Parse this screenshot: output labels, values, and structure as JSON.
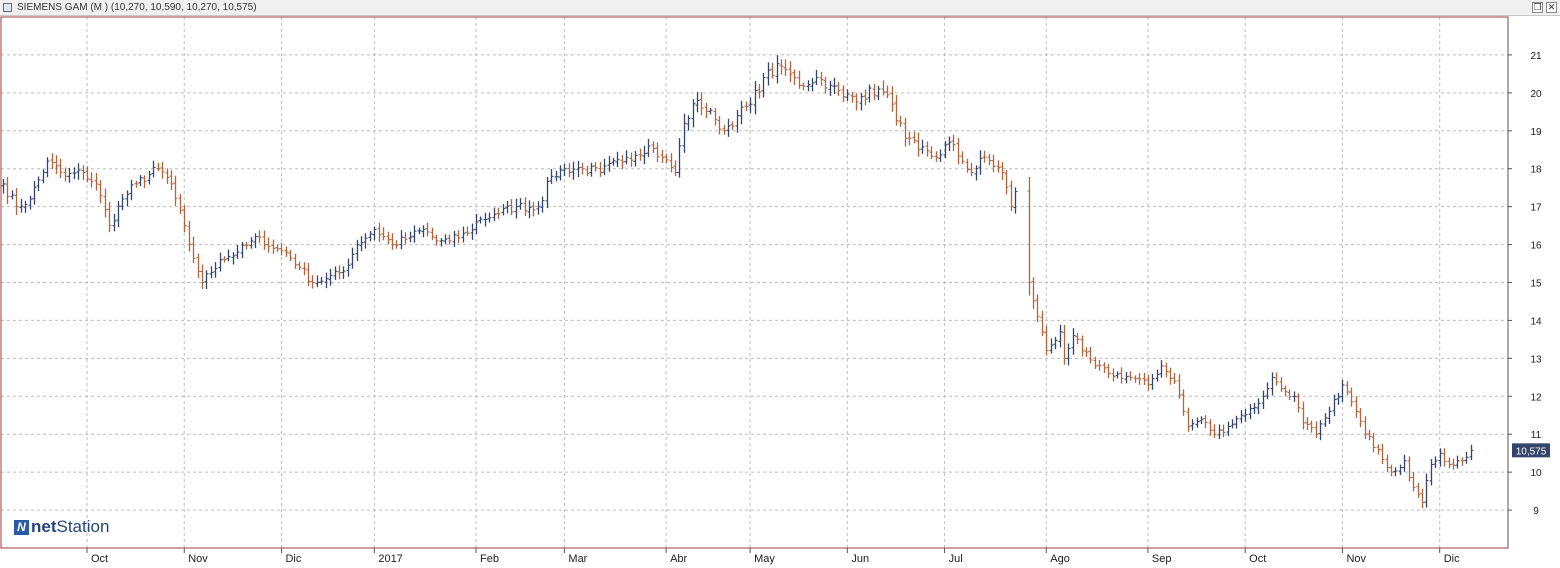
{
  "window": {
    "title": "SIEMENS GAM (M ) (10,270, 10,590, 10,270, 10,575)",
    "restore_glyph": "❐",
    "close_glyph": "✕"
  },
  "logo": {
    "mark": "N",
    "part1": "net",
    "part2": "Station"
  },
  "colors": {
    "up": "#33456b",
    "down": "#b5633a",
    "grid": "#bdbdbd",
    "frame": "#a33a3a",
    "price_tag": "#33456b"
  },
  "chart_data": {
    "type": "ohlc",
    "last_price": 10.575,
    "last_price_label": "10,575",
    "ylim": [
      8.0,
      22.0
    ],
    "y_ticks": [
      9,
      10,
      11,
      12,
      13,
      14,
      15,
      16,
      17,
      18,
      19,
      20,
      21
    ],
    "x_ticks": [
      {
        "label": "Oct",
        "i": 19
      },
      {
        "label": "Nov",
        "i": 41
      },
      {
        "label": "Dic",
        "i": 63
      },
      {
        "label": "2017",
        "i": 84
      },
      {
        "label": "Feb",
        "i": 107
      },
      {
        "label": "Mar",
        "i": 127
      },
      {
        "label": "Abr",
        "i": 150
      },
      {
        "label": "May",
        "i": 169
      },
      {
        "label": "Jun",
        "i": 191
      },
      {
        "label": "Jul",
        "i": 213
      },
      {
        "label": "Ago",
        "i": 236
      },
      {
        "label": "Sep",
        "i": 259
      },
      {
        "label": "Oct",
        "i": 281
      },
      {
        "label": "Nov",
        "i": 303
      },
      {
        "label": "Dic",
        "i": 325
      }
    ],
    "x_range": [
      0,
      340
    ],
    "x_gaps": [
      {
        "from": 229,
        "to": 232
      },
      {
        "from": 332,
        "to": 340
      }
    ],
    "close_path": [
      [
        0,
        17.6
      ],
      [
        3,
        17.0
      ],
      [
        6,
        17.2
      ],
      [
        10,
        18.2
      ],
      [
        14,
        17.8
      ],
      [
        18,
        17.9
      ],
      [
        21,
        17.6
      ],
      [
        24,
        16.5
      ],
      [
        27,
        17.2
      ],
      [
        30,
        17.6
      ],
      [
        35,
        18.0
      ],
      [
        38,
        17.6
      ],
      [
        42,
        16.0
      ],
      [
        45,
        15.0
      ],
      [
        49,
        15.6
      ],
      [
        53,
        15.8
      ],
      [
        58,
        16.2
      ],
      [
        61,
        15.9
      ],
      [
        64,
        15.8
      ],
      [
        67,
        15.4
      ],
      [
        70,
        15.0
      ],
      [
        73,
        15.1
      ],
      [
        77,
        15.3
      ],
      [
        80,
        16.0
      ],
      [
        84,
        16.4
      ],
      [
        88,
        16.0
      ],
      [
        92,
        16.2
      ],
      [
        95,
        16.4
      ],
      [
        98,
        16.1
      ],
      [
        101,
        16.1
      ],
      [
        105,
        16.3
      ],
      [
        107,
        16.6
      ],
      [
        111,
        16.8
      ],
      [
        116,
        17.0
      ],
      [
        121,
        17.0
      ],
      [
        124,
        17.8
      ],
      [
        127,
        18.0
      ],
      [
        131,
        18.0
      ],
      [
        135,
        17.9
      ],
      [
        141,
        18.3
      ],
      [
        146,
        18.6
      ],
      [
        149,
        18.3
      ],
      [
        152,
        17.9
      ],
      [
        154,
        19.2
      ],
      [
        157,
        19.8
      ],
      [
        161,
        19.3
      ],
      [
        163,
        19.0
      ],
      [
        166,
        19.4
      ],
      [
        169,
        19.7
      ],
      [
        172,
        20.4
      ],
      [
        176,
        20.7
      ],
      [
        178,
        20.5
      ],
      [
        180,
        20.2
      ],
      [
        184,
        20.4
      ],
      [
        187,
        20.2
      ],
      [
        190,
        19.9
      ],
      [
        194,
        19.9
      ],
      [
        198,
        20.1
      ],
      [
        201,
        19.7
      ],
      [
        204,
        18.8
      ],
      [
        207,
        18.5
      ],
      [
        211,
        18.3
      ],
      [
        214,
        18.7
      ],
      [
        217,
        18.2
      ],
      [
        219,
        17.9
      ],
      [
        222,
        18.3
      ],
      [
        226,
        17.9
      ],
      [
        228,
        17.0
      ],
      [
        229,
        17.4
      ],
      [
        232,
        15.0
      ],
      [
        234,
        14.1
      ],
      [
        236,
        13.2
      ],
      [
        239,
        13.7
      ],
      [
        240,
        13.0
      ],
      [
        242,
        13.6
      ],
      [
        244,
        13.2
      ],
      [
        247,
        12.8
      ],
      [
        250,
        12.6
      ],
      [
        255,
        12.5
      ],
      [
        259,
        12.3
      ],
      [
        262,
        12.8
      ],
      [
        265,
        12.4
      ],
      [
        268,
        11.2
      ],
      [
        271,
        11.4
      ],
      [
        274,
        11.0
      ],
      [
        277,
        11.2
      ],
      [
        280,
        11.5
      ],
      [
        283,
        11.7
      ],
      [
        285,
        12.0
      ],
      [
        287,
        12.5
      ],
      [
        289,
        12.2
      ],
      [
        292,
        12.0
      ],
      [
        294,
        11.3
      ],
      [
        297,
        11.0
      ],
      [
        300,
        11.6
      ],
      [
        303,
        12.3
      ],
      [
        306,
        11.6
      ],
      [
        308,
        11.0
      ],
      [
        311,
        10.6
      ],
      [
        314,
        10.0
      ],
      [
        317,
        10.3
      ],
      [
        319,
        9.6
      ],
      [
        321,
        9.2
      ],
      [
        323,
        10.2
      ],
      [
        325,
        10.5
      ],
      [
        327,
        10.2
      ],
      [
        330,
        10.3
      ],
      [
        332,
        10.575
      ]
    ]
  }
}
